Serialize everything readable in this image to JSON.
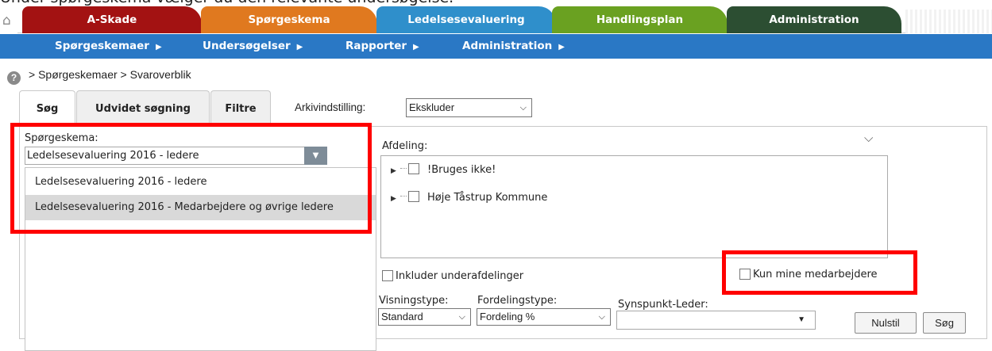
{
  "caption": "Under spørgeskema vælger du den relevante undersøgelse.",
  "top_tabs": [
    "A-Skade",
    "Spørgeskema",
    "Ledelsesevaluering",
    "Handlingsplan",
    "Administration"
  ],
  "sub_nav": [
    "Spørgeskemaer",
    "Undersøgelser",
    "Rapporter",
    "Administration"
  ],
  "breadcrumb": "> Spørgeskemaer > Svaroverblik",
  "search_tabs": [
    "Søg",
    "Udvidet søgning",
    "Filtre"
  ],
  "archive": {
    "label": "Arkivindstilling:",
    "value": "Ekskluder"
  },
  "questionnaire": {
    "label": "Spørgeskema:",
    "value": "Ledelsesevaluering 2016 - ledere",
    "options": [
      "Ledelsesevaluering 2016 - ledere",
      "Ledelsesevaluering 2016 - Medarbejdere og øvrige ledere"
    ]
  },
  "department": {
    "label": "Afdeling:",
    "tree": [
      "!Bruges ikke!",
      "Høje Tåstrup Kommune"
    ]
  },
  "include_sub": "Inkluder underafdelinger",
  "only_mine": "Kun mine medarbejdere",
  "view_type": {
    "label": "Visningstype:",
    "value": "Standard"
  },
  "dist_type": {
    "label": "Fordelingstype:",
    "value": "Fordeling %"
  },
  "leader": {
    "label": "Synspunkt-Leder:",
    "value": ""
  },
  "buttons": {
    "reset": "Nulstil",
    "search": "Søg"
  },
  "colors": {
    "askade": "#a31212",
    "spg": "#e0791f",
    "led": "#2f8fcb",
    "hand": "#6aa121",
    "adm": "#2c4e32",
    "subnav": "#2a78c5",
    "highlight": "#ff0000"
  }
}
